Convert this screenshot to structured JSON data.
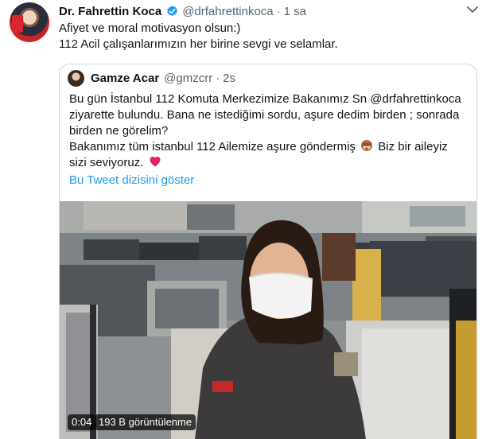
{
  "author": {
    "name": "Dr. Fahrettin Koca",
    "handle": "@drfahrettinkoca",
    "separator": "·",
    "time": "1 sa"
  },
  "tweet": {
    "line1": "Afiyet ve moral motivasyon olsun:)",
    "line2": "112 Acil çalışanlarımızın her birine sevgi ve selamlar."
  },
  "quoted": {
    "name": "Gamze Acar",
    "handle": "@gmzcrr",
    "separator": "·",
    "time": "2s",
    "line1": "Bu gün İstanbul 112 Komuta Merkezimize Bakanımız Sn @drfahrettinkoca",
    "line2": "ziyarette bulundu. Bana ne istediğimi sordu, aşure dedim birden ; sonrada",
    "line3": "birden ne görelim?",
    "line4a": "Bakanımız tüm istanbul 112 Ailemize aşure göndermiş",
    "line4b": "Biz bir aileyiz",
    "line5": "sizi seviyoruz.",
    "show_thread": "Bu Tweet dizisini göster"
  },
  "video": {
    "duration": "0:04",
    "views": "193 B görüntülenme"
  },
  "colors": {
    "link": "#1d9bf0",
    "secondary_text": "#536471",
    "verified": "#1d9bf0",
    "heart": "#e0245e"
  },
  "icons": {
    "verified": "verified-badge-icon",
    "menu": "chevron-down-icon",
    "monkey_emoji": "see-no-evil-monkey-icon",
    "heart_emoji": "red-heart-icon"
  }
}
